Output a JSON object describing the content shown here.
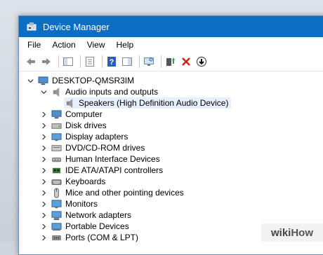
{
  "window": {
    "title": "Device Manager"
  },
  "menu": [
    "File",
    "Action",
    "View",
    "Help"
  ],
  "tree": {
    "root": "DESKTOP-QMSR3IM",
    "expanded_group": "Audio inputs and outputs",
    "child": "Speakers (High Definition Audio Device)",
    "items": [
      {
        "label": "Computer",
        "icon": "computer-icon"
      },
      {
        "label": "Disk drives",
        "icon": "disk-drive-icon"
      },
      {
        "label": "Display adapters",
        "icon": "display-adapter-icon"
      },
      {
        "label": "DVD/CD-ROM drives",
        "icon": "dvd-drive-icon"
      },
      {
        "label": "Human Interface Devices",
        "icon": "hid-icon"
      },
      {
        "label": "IDE ATA/ATAPI controllers",
        "icon": "ide-controller-icon"
      },
      {
        "label": "Keyboards",
        "icon": "keyboard-icon"
      },
      {
        "label": "Mice and other pointing devices",
        "icon": "mouse-icon"
      },
      {
        "label": "Monitors",
        "icon": "monitor-icon"
      },
      {
        "label": "Network adapters",
        "icon": "network-adapter-icon"
      },
      {
        "label": "Portable Devices",
        "icon": "portable-device-icon"
      },
      {
        "label": "Ports (COM & LPT)",
        "icon": "ports-icon"
      }
    ]
  },
  "watermark": {
    "brand_a": "wiki",
    "brand_b": "How"
  }
}
